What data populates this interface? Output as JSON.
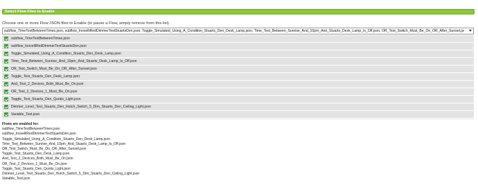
{
  "section": {
    "title": "Select Flow Files to Enable"
  },
  "instruction": "Choose one or more Flow JSON files to Enable (to pause a Flow, simply remove from this list)",
  "select_value": "subflow_TimeTestBetweenTimes.json, subflow_InovelliRedDimmerTestStuartsDen.json, Toggle_Simulated_Using_A_Condition_Stuarts_Den_Desk_Lamp.json, Time_Test_Between_Sunrise_And_10pm_And_Stuarts_Desk_Lamp_Is_Off.json, OR_Test_Switch_Must_Be_On_OR_After_Sunset.json, Toggle_Test_Stuarts_Den_De...",
  "options": [
    "subflow_TimeTestBetweenTimes.json",
    "subflow_InovelliRedDimmerTestStuartsDen.json",
    "Toggle_Simulated_Using_A_Condition_Stuarts_Den_Desk_Lamp.json",
    "Time_Test_Between_Sunrise_And_10pm_And_Stuarts_Desk_Lamp_Is_Off.json",
    "OR_Test_Switch_Must_Be_On_OR_After_Sunset.json",
    "Toggle_Test_Stuarts_Den_Desk_Lamp.json",
    "And_Test_2_Devices_Both_Must_Be_On.json",
    "OR_Test_2_Devices_1_Must_Be_On.json",
    "Toggle_Test_Stuarts_Den_Quntis_Light.json",
    "Dimmer_Level_Test_Stuarts_Den_Hutch_Switch_5_Dim_Stuarts_Den_Ceiling_Light.json",
    "Variable_Test.json"
  ],
  "enabled": {
    "header": "Flows are enabled for:",
    "items": [
      "subflow_TimeTestBetweenTimes.json",
      "subflow_InovelliRedDimmerTestStuartsDen.json",
      "Toggle_Simulated_Using_A_Condition_Stuarts_Den_Desk_Lamp.json",
      "Time_Test_Between_Sunrise_And_10pm_And_Stuarts_Desk_Lamp_Is_Off.json",
      "OR_Test_Switch_Must_Be_On_OR_After_Sunset.json",
      "Toggle_Test_Stuarts_Den_Desk_Lamp.json",
      "And_Test_2_Devices_Both_Must_Be_On.json",
      "OR_Test_2_Devices_1_Must_Be_On.json",
      "Toggle_Test_Stuarts_Den_Quntis_Light.json",
      "Dimmer_Level_Test_Stuarts_Den_Hutch_Switch_5_Dim_Stuarts_Den_Ceiling_Light.json",
      "Variable_Test.json"
    ]
  },
  "colors": {
    "accent": "#8cc63f",
    "check": "#3c9a3c",
    "option_bg": "#e3e3e3"
  },
  "icons": {
    "checkbox": "checkbox-checked-icon",
    "dropdown": "chevron-down-icon"
  }
}
